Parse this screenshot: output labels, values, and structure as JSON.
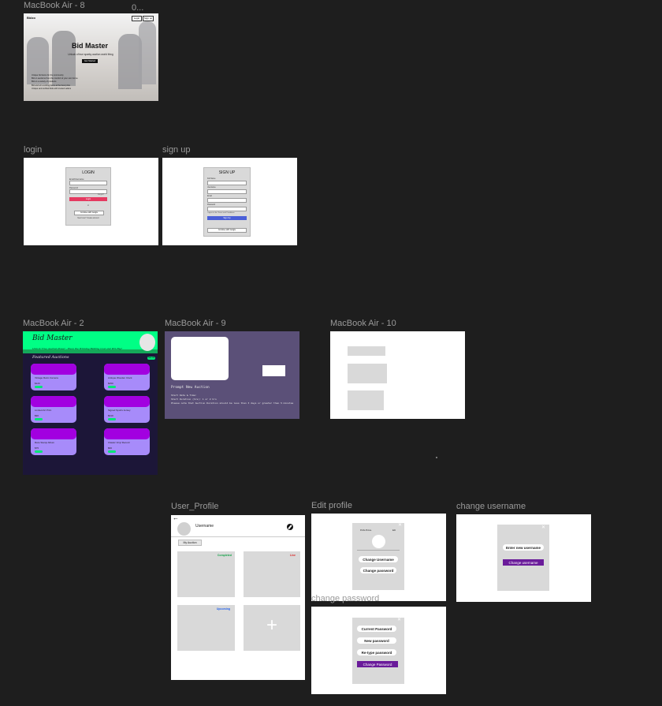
{
  "frames": {
    "macbook8": {
      "label": "MacBook Air - 8",
      "brand": "Bidzo",
      "nav_buttons": [
        "Login",
        "Sign up"
      ],
      "title": "Bid Master",
      "subtitle": "Unlock of true sparky auction world thing",
      "cta": "Get Started",
      "bullets": [
        "Unique bid items for the community",
        "Bid on auctions from the comfort of your own home",
        "Bid on a variety of products",
        "Bid and win exciting items at the best price",
        "Unique and verified bids with trusted sellers"
      ]
    },
    "overflow_label": "0...",
    "login": {
      "label": "login",
      "heading": "LOGIN",
      "fields": [
        "Email/Username",
        "Password"
      ],
      "forgot": "Forgot?",
      "button": "Login",
      "or": "or",
      "google": "Continue with Google",
      "footer": "New here? Create account"
    },
    "signup": {
      "label": "sign up",
      "heading": "SIGN UP",
      "fields": [
        "Full Name",
        "Username",
        "Email",
        "Password"
      ],
      "checkbox": "I agree to the Terms and Conditions",
      "button": "Sign Up",
      "google": "Continue with Google"
    },
    "macbook2": {
      "label": "MacBook Air - 2",
      "title": "Bid Master",
      "tagline": "Unlock True Auction Power - Place the Winning Bidding Cost and Win Big!",
      "section": "Featured Auctions",
      "more": "See All",
      "auctions": [
        {
          "name": "Vintage Retro Camera",
          "price": "$120",
          "bid": "Bid Now"
        },
        {
          "name": "Antique Wooden Clock",
          "price": "$250",
          "bid": "Bid Now"
        },
        {
          "name": "Limited Art Print",
          "price": "$90",
          "bid": "Bid Now"
        },
        {
          "name": "Signed Sports Jersey",
          "price": "$310",
          "bid": "Bid Now"
        },
        {
          "name": "Rare Stamp Album",
          "price": "$75",
          "bid": "Bid Now"
        },
        {
          "name": "Classic Vinyl Record",
          "price": "$60",
          "bid": "Bid Now"
        }
      ]
    },
    "macbook9": {
      "label": "MacBook Air - 9",
      "heading": "Prompt New Auction",
      "lines": [
        "Start Date & Time:",
        "Start Duration (hrs): 1 or 2 hrs",
        "Please note that Auction Duration should be less than 3 days or greater than 5 minutes"
      ]
    },
    "macbook10": {
      "label": "MacBook Air - 10"
    },
    "user_profile": {
      "label": "User_Profile",
      "back": "←",
      "username": "Username",
      "tab": "My Auction",
      "tiles": [
        {
          "status": "Completed",
          "color": "#16a34a"
        },
        {
          "status": "Live",
          "color": "#dc2626"
        },
        {
          "status": "Upcoming",
          "color": "#2563eb"
        },
        {
          "status": "",
          "color": ""
        }
      ],
      "add_symbol": "+"
    },
    "edit_profile": {
      "label": "Edit profile",
      "profile_pic": "Profile Picture",
      "edit": "Edit",
      "close": "✕",
      "buttons": [
        "Change Username",
        "Change password"
      ]
    },
    "change_username": {
      "label": "change username",
      "close": "✕",
      "input": "Enter new username",
      "button": "Change username"
    },
    "change_password": {
      "label": "change password",
      "close": "✕",
      "fields": [
        "Current Password",
        "New password",
        "Re-type password"
      ],
      "button": "Change Password"
    }
  },
  "colors": {
    "canvas": "#1e1e1e",
    "label": "#9a9a9a",
    "green_header": "#00ff85",
    "dark_purple": "#5b5078",
    "purple_button": "#6a1b9a",
    "login_button": "#e53960",
    "signup_button": "#4a5fd8"
  }
}
